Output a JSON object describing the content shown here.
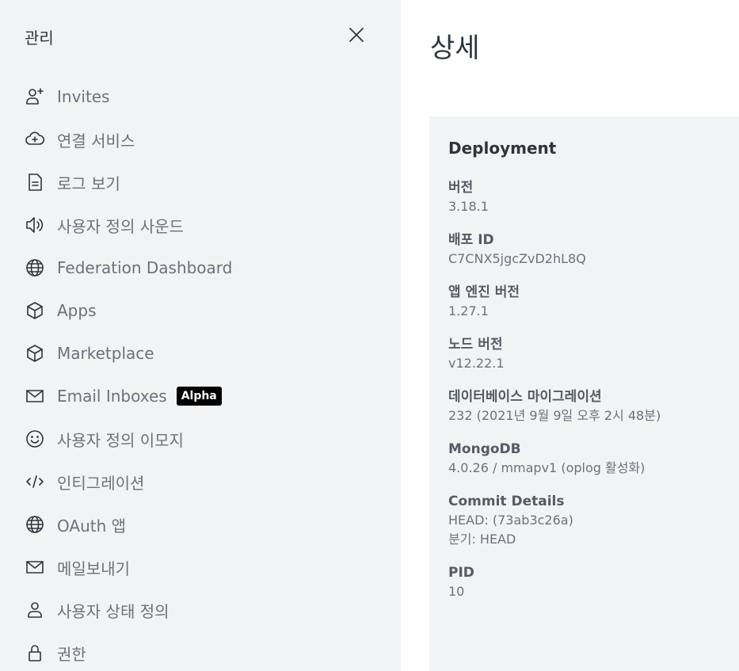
{
  "sidebar": {
    "title": "관리",
    "items": [
      {
        "label": "Invites",
        "icon": "user-plus-icon"
      },
      {
        "label": "연결 서비스",
        "icon": "cloud-plus-icon"
      },
      {
        "label": "로그 보기",
        "icon": "file-text-icon"
      },
      {
        "label": "사용자 정의 사운드",
        "icon": "speaker-icon"
      },
      {
        "label": "Federation Dashboard",
        "icon": "globe-icon"
      },
      {
        "label": "Apps",
        "icon": "cube-icon"
      },
      {
        "label": "Marketplace",
        "icon": "cube-icon"
      },
      {
        "label": "Email Inboxes",
        "icon": "mail-icon",
        "badge": "Alpha"
      },
      {
        "label": "사용자 정의 이모지",
        "icon": "emoji-icon"
      },
      {
        "label": "인티그레이션",
        "icon": "code-icon"
      },
      {
        "label": "OAuth 앱",
        "icon": "globe-icon"
      },
      {
        "label": "메일보내기",
        "icon": "mail-icon"
      },
      {
        "label": "사용자 상태 정의",
        "icon": "user-icon"
      },
      {
        "label": "권한",
        "icon": "lock-icon"
      }
    ]
  },
  "main": {
    "title": "상세",
    "panel": {
      "title": "Deployment",
      "fields": [
        {
          "label": "버전",
          "values": [
            "3.18.1"
          ]
        },
        {
          "label": "배포 ID",
          "values": [
            "C7CNX5jgcZvD2hL8Q"
          ]
        },
        {
          "label": "앱 엔진 버전",
          "values": [
            "1.27.1"
          ]
        },
        {
          "label": "노드 버전",
          "values": [
            "v12.22.1"
          ]
        },
        {
          "label": "데이터베이스 마이그레이션",
          "values": [
            "232 (2021년 9월 9일 오후 2시 48분)"
          ]
        },
        {
          "label": "MongoDB",
          "values": [
            "4.0.26 / mmapv1 (oplog 활성화)"
          ]
        },
        {
          "label": "Commit Details",
          "values": [
            "HEAD: (73ab3c26a)",
            "분기: HEAD"
          ]
        },
        {
          "label": "PID",
          "values": [
            "10"
          ]
        }
      ]
    }
  }
}
